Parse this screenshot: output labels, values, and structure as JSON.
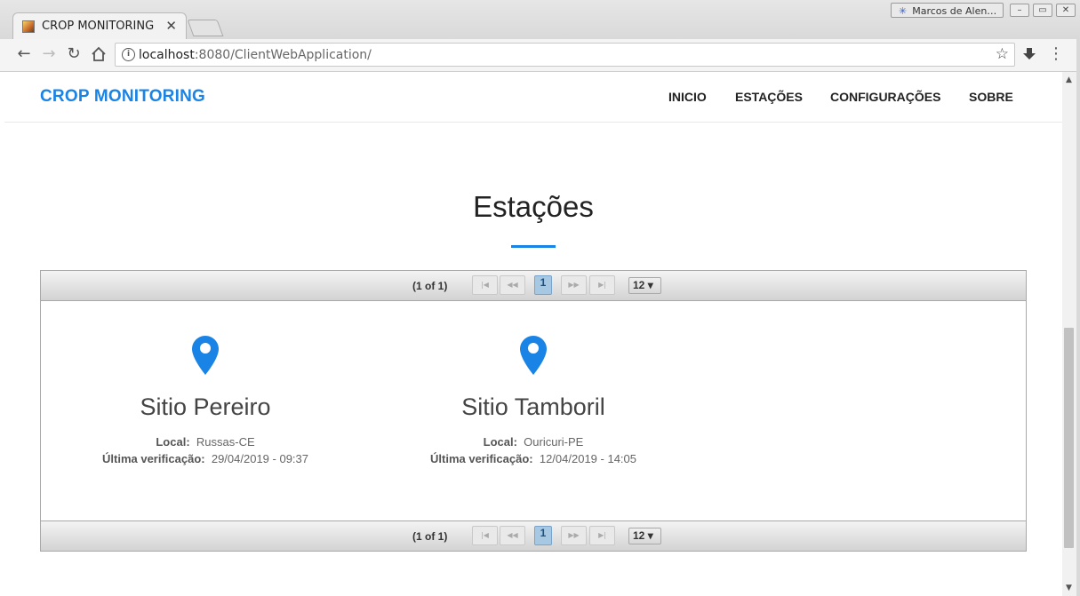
{
  "browser": {
    "tab_title": "CROP MONITORING",
    "profile_name": "Marcos de Alen…",
    "url_host": "localhost",
    "url_rest": ":8080/ClientWebApplication/",
    "window_buttons": [
      "–",
      "▭",
      "✕"
    ]
  },
  "navbar": {
    "brand": "CROP MONITORING",
    "items": [
      "INICIO",
      "ESTAÇÕES",
      "CONFIGURAÇÕES",
      "SOBRE"
    ]
  },
  "page": {
    "title": "Estações",
    "accent_color": "#1a83e6"
  },
  "pager": {
    "count": "(1 of 1)",
    "current_page": "1",
    "rows_per_page": "12",
    "nav_icons": [
      "first-page-icon",
      "prev-page-icon",
      "next-page-icon",
      "last-page-icon"
    ]
  },
  "stations": [
    {
      "name": "Sitio Pereiro",
      "local_label": "Local:",
      "local": "Russas-CE",
      "check_label": "Última verificação:",
      "last_check": "29/04/2019 - 09:37",
      "icon": "map-pin-icon"
    },
    {
      "name": "Sitio Tamboril",
      "local_label": "Local:",
      "local": "Ouricuri-PE",
      "check_label": "Última verificação:",
      "last_check": "12/04/2019 - 14:05",
      "icon": "map-pin-icon"
    }
  ]
}
